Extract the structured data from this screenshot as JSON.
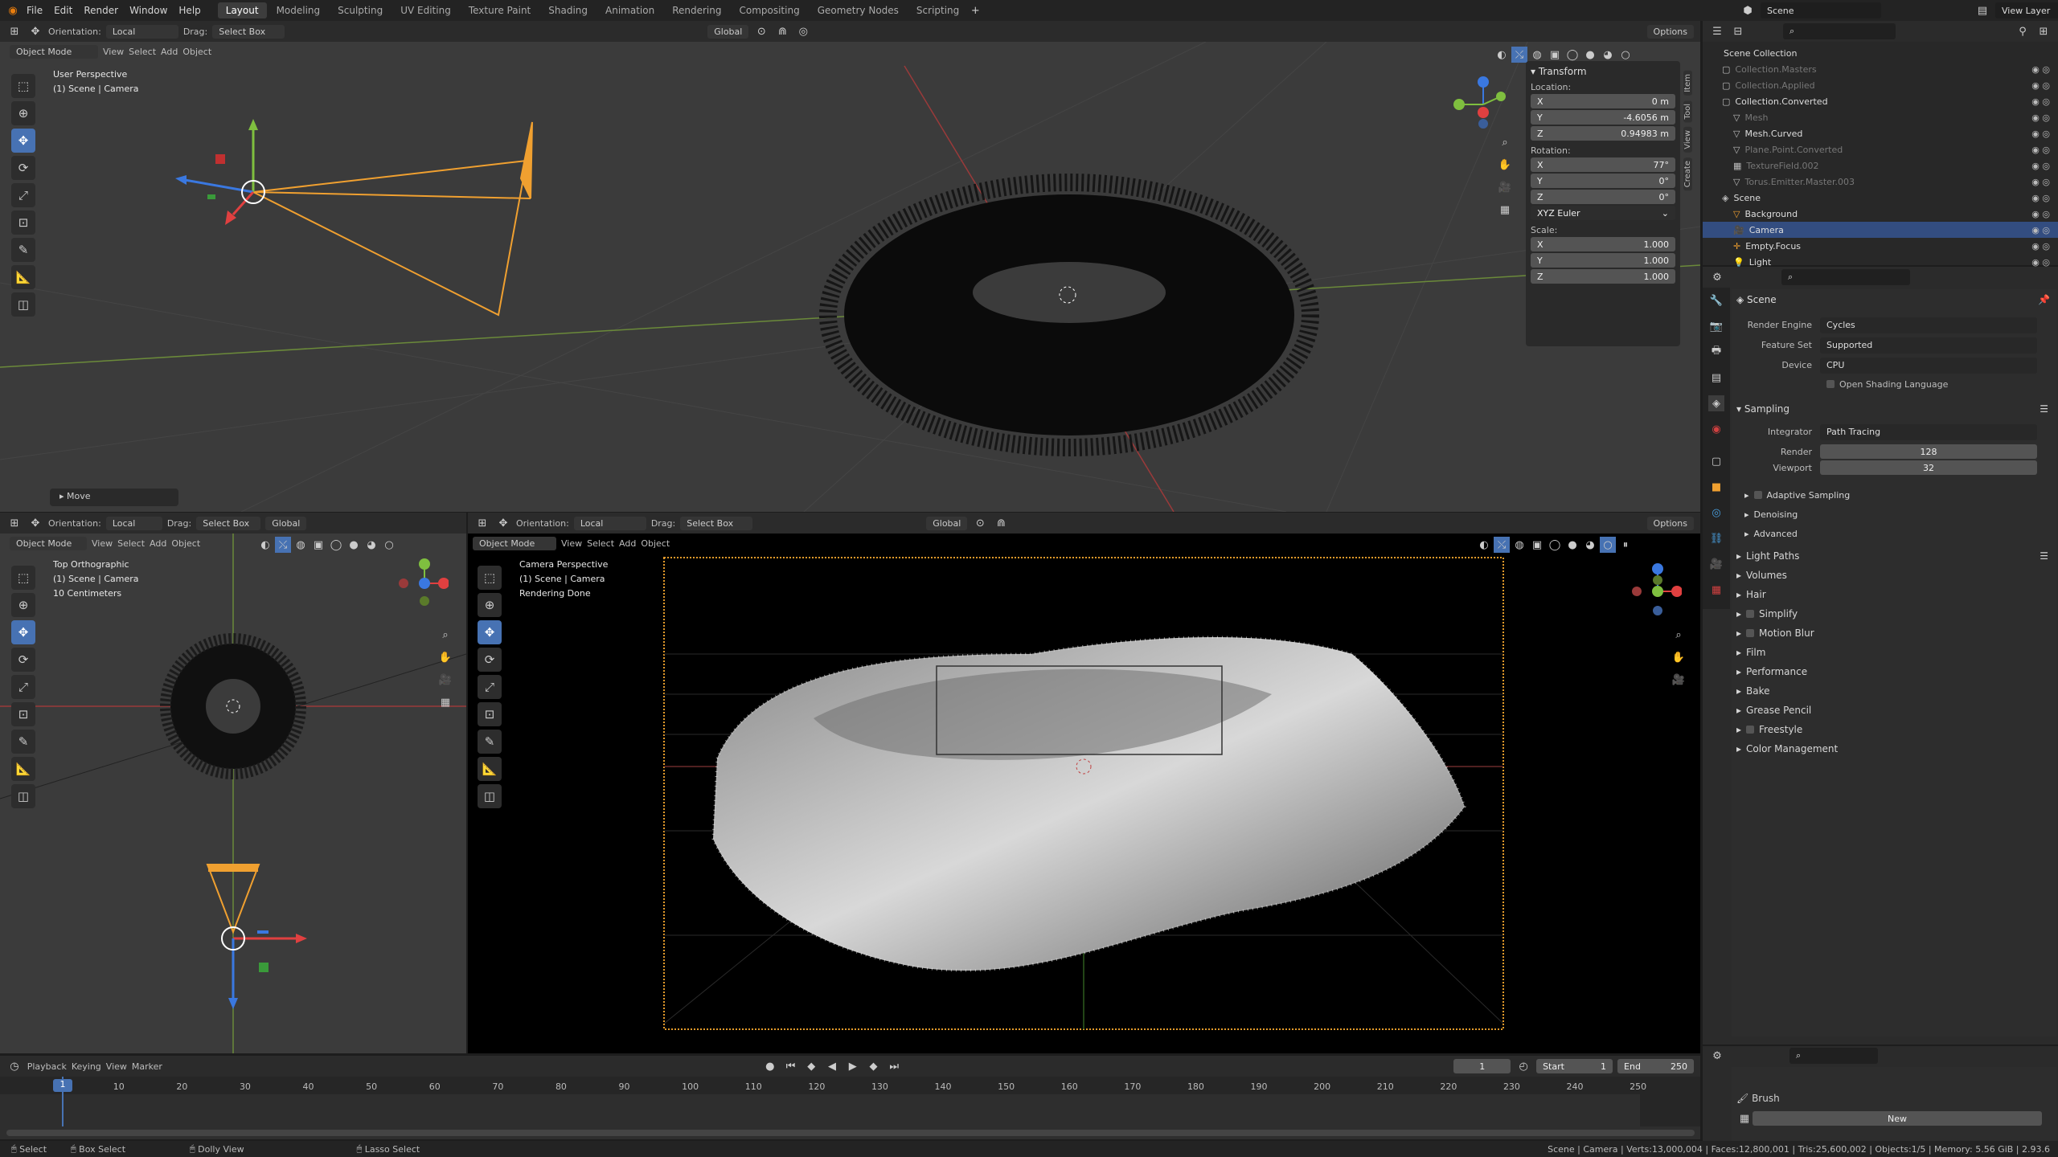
{
  "topbar": {
    "menus": [
      "File",
      "Edit",
      "Render",
      "Window",
      "Help"
    ],
    "workspaces": [
      "Layout",
      "Modeling",
      "Sculpting",
      "UV Editing",
      "Texture Paint",
      "Shading",
      "Animation",
      "Rendering",
      "Compositing",
      "Geometry Nodes",
      "Scripting"
    ],
    "active_workspace": "Layout",
    "scene": "Scene",
    "view_layer": "View Layer"
  },
  "header_top": {
    "orientation_label": "Orientation:",
    "orientation_value": "Local",
    "drag_label": "Drag:",
    "drag_value": "Select Box",
    "global": "Global",
    "options": "Options"
  },
  "viewport_top": {
    "mode": "Object Mode",
    "menus": [
      "View",
      "Select",
      "Add",
      "Object"
    ],
    "line1": "User Perspective",
    "line2": "(1) Scene | Camera",
    "operator": "Move",
    "side_tabs": [
      "Item",
      "Tool",
      "View",
      "Create"
    ]
  },
  "transform": {
    "title": "Transform",
    "location_label": "Location:",
    "loc": [
      {
        "axis": "X",
        "value": "0 m"
      },
      {
        "axis": "Y",
        "value": "-4.6056 m"
      },
      {
        "axis": "Z",
        "value": "0.94983 m"
      }
    ],
    "rotation_label": "Rotation:",
    "rot": [
      {
        "axis": "X",
        "value": "77°"
      },
      {
        "axis": "Y",
        "value": "0°"
      },
      {
        "axis": "Z",
        "value": "0°"
      }
    ],
    "euler": "XYZ Euler",
    "scale_label": "Scale:",
    "scale": [
      {
        "axis": "X",
        "value": "1.000"
      },
      {
        "axis": "Y",
        "value": "1.000"
      },
      {
        "axis": "Z",
        "value": "1.000"
      }
    ]
  },
  "viewport_bl": {
    "orientation_label": "Orientation:",
    "orientation_value": "Local",
    "drag_label": "Drag:",
    "drag_value": "Select Box",
    "global": "Global",
    "mode": "Object Mode",
    "menus": [
      "View",
      "Select",
      "Add",
      "Object"
    ],
    "line1": "Top Orthographic",
    "line2": "(1) Scene | Camera",
    "line3": "10 Centimeters"
  },
  "viewport_br": {
    "orientation_label": "Orientation:",
    "orientation_value": "Local",
    "drag_label": "Drag:",
    "drag_value": "Select Box",
    "global": "Global",
    "options": "Options",
    "mode": "Object Mode",
    "menus": [
      "View",
      "Select",
      "Add",
      "Object"
    ],
    "line1": "Camera Perspective",
    "line2": "(1) Scene | Camera",
    "line3": "Rendering Done"
  },
  "outliner": {
    "root": "Scene Collection",
    "items": [
      {
        "name": "Collection.Masters",
        "dim": true
      },
      {
        "name": "Collection.Applied",
        "dim": true
      },
      {
        "name": "Collection.Converted",
        "dim": false
      },
      {
        "name": "Mesh",
        "dim": true
      },
      {
        "name": "Mesh.Curved",
        "dim": false
      },
      {
        "name": "Plane.Point.Converted",
        "dim": true
      },
      {
        "name": "TextureField.002",
        "dim": true
      },
      {
        "name": "Torus.Emitter.Master.003",
        "dim": true
      },
      {
        "name": "Scene",
        "dim": false
      },
      {
        "name": "Background",
        "dim": false
      },
      {
        "name": "Camera",
        "dim": false,
        "selected": true
      },
      {
        "name": "Empty.Focus",
        "dim": false
      },
      {
        "name": "Light",
        "dim": false
      }
    ]
  },
  "properties": {
    "scene": "Scene",
    "render_engine_label": "Render Engine",
    "render_engine": "Cycles",
    "feature_set_label": "Feature Set",
    "feature_set": "Supported",
    "device_label": "Device",
    "device": "CPU",
    "osl": "Open Shading Language",
    "sampling": "Sampling",
    "integrator_label": "Integrator",
    "integrator": "Path Tracing",
    "render_label": "Render",
    "render_samples": "128",
    "viewport_label": "Viewport",
    "viewport_samples": "32",
    "sub": [
      "Adaptive Sampling",
      "Denoising",
      "Advanced"
    ],
    "panels": [
      "Light Paths",
      "Volumes",
      "Hair",
      "Simplify",
      "Motion Blur",
      "Film",
      "Performance",
      "Bake",
      "Grease Pencil",
      "Freestyle",
      "Color Management"
    ]
  },
  "timeline": {
    "menus": [
      "Playback",
      "Keying",
      "View",
      "Marker"
    ],
    "current_frame": "1",
    "start_label": "Start",
    "start": "1",
    "end_label": "End",
    "end": "250",
    "ticks": [
      "1",
      "10",
      "20",
      "30",
      "40",
      "50",
      "60",
      "70",
      "80",
      "90",
      "100",
      "110",
      "120",
      "130",
      "140",
      "150",
      "160",
      "170",
      "180",
      "190",
      "200",
      "210",
      "220",
      "230",
      "240",
      "250"
    ]
  },
  "brush_panel": {
    "name": "Brush",
    "new": "New"
  },
  "statusbar": {
    "select": "Select",
    "box": "Box Select",
    "dolly": "Dolly View",
    "lasso": "Lasso Select",
    "info": "Scene | Camera | Verts:13,000,004 | Faces:12,800,001 | Tris:25,600,002 | Objects:1/5 | Memory: 5.56 GiB | 2.93.6"
  }
}
